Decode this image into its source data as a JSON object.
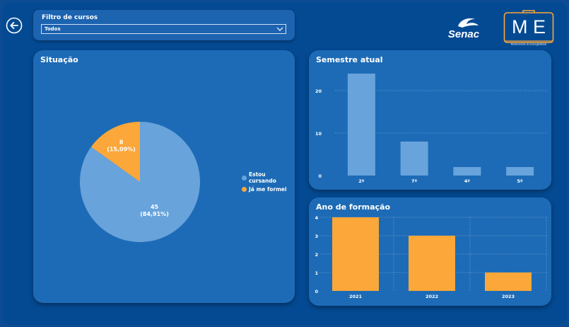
{
  "filter": {
    "title": "Filtro de cursos",
    "selected": "Todos"
  },
  "brand": {
    "senac_text": "Senac",
    "me_letters": "M E",
    "me_subtitle": "Monitoramento de Empregabilidade"
  },
  "colors": {
    "page_bg": "#044a93",
    "card_bg": "#1d6bb6",
    "series_blue": "#68a3dc",
    "series_orange": "#fba739",
    "gridline": "#6d9fd4"
  },
  "icons": {
    "back": "arrow-left-circle-icon",
    "dropdown": "chevron-down-icon"
  },
  "situacao": {
    "title": "Situação"
  },
  "semestre": {
    "title": "Semestre atual"
  },
  "ano": {
    "title": "Ano de formação"
  },
  "chart_data": [
    {
      "type": "pie",
      "title": "Situação",
      "categories": [
        "Estou cursando",
        "Já me formei"
      ],
      "values": [
        45,
        8
      ],
      "labels": [
        [
          "45",
          "(84,91%)"
        ],
        [
          "8",
          "(15,09%)"
        ]
      ],
      "colors": [
        "#68a3dc",
        "#fba739"
      ],
      "legend": "right"
    },
    {
      "type": "bar",
      "title": "Semestre atual",
      "categories": [
        "2º",
        "7º",
        "4º",
        "5º"
      ],
      "values": [
        24,
        8,
        2,
        2
      ],
      "yticks": [
        0,
        10,
        20
      ],
      "ylim": [
        0,
        24
      ],
      "color": "#68a3dc",
      "grid": true
    },
    {
      "type": "bar",
      "title": "Ano de formação",
      "categories": [
        "2021",
        "2022",
        "2023"
      ],
      "values": [
        4,
        3,
        1
      ],
      "yticks": [
        0,
        1,
        2,
        3,
        4
      ],
      "ylim": [
        0,
        4
      ],
      "color": "#fba739",
      "grid": true
    }
  ]
}
